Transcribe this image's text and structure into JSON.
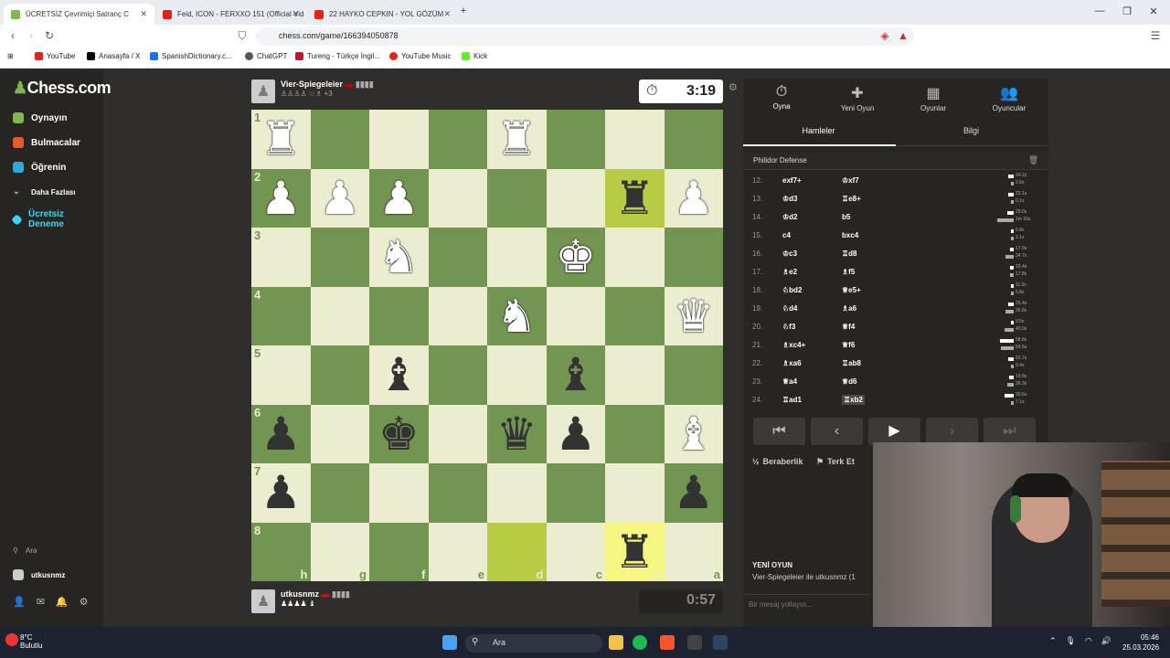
{
  "browser": {
    "tabs": [
      {
        "title": "ÜCRETSİZ Çevrimiçi Satranç C",
        "color": "#81b64c"
      },
      {
        "title": "Feid, ICON - FERXXO 151 (Official Vid",
        "color": "#e62117"
      },
      {
        "title": "22 HAYKO CEPKIN - YOL GÖZÜM",
        "color": "#e62117"
      }
    ],
    "url": "chess.com/game/166394050878",
    "bookmarks": [
      {
        "label": "YouTube",
        "color": "#e62117"
      },
      {
        "label": "Anasayfa / X",
        "color": "#000000"
      },
      {
        "label": "SpanishDictionary.c...",
        "color": "#1a73e8"
      },
      {
        "label": "ChatGPT",
        "color": "#555555"
      },
      {
        "label": "Tureng - Türkçe İngil...",
        "color": "#c4153b"
      },
      {
        "label": "YouTube Music",
        "color": "#e62117"
      },
      {
        "label": "Kick",
        "color": "#53fc18"
      }
    ]
  },
  "sidebar": {
    "logo": "Chess.com",
    "items": [
      {
        "label": "Oynayın",
        "color": "#81b64c"
      },
      {
        "label": "Bulmacalar",
        "color": "#e8582a"
      },
      {
        "label": "Öğrenin",
        "color": "#2da8dd"
      },
      {
        "label": "Daha Fazlası",
        "color": "#bbbbbb"
      },
      {
        "label": "Ücretsiz Deneme",
        "color": "#3ad5f5"
      }
    ],
    "search": "Ara",
    "username": "utkusnmz"
  },
  "game": {
    "top_player": {
      "name": "Vier-Spiegeleier",
      "rating": "+3"
    },
    "bottom_player": {
      "name": "utkusnmz"
    },
    "top_clock": "3:19",
    "bottom_clock": "0:57",
    "board": [
      [
        "wR",
        "",
        "",
        "",
        "wR",
        "",
        "",
        ""
      ],
      [
        "wP",
        "wP",
        "wP",
        "",
        "",
        "",
        "bR",
        "wP"
      ],
      [
        "",
        "",
        "wN",
        "",
        "",
        "wK",
        "",
        ""
      ],
      [
        "",
        "",
        "",
        "",
        "wN",
        "",
        "",
        "wQ"
      ],
      [
        "",
        "",
        "bB",
        "",
        "",
        "bB",
        "",
        ""
      ],
      [
        "bP",
        "",
        "bK",
        "",
        "bQ",
        "bP",
        "",
        "wB"
      ],
      [
        "bP",
        "",
        "",
        "",
        "",
        "",
        "",
        "bP"
      ],
      [
        "",
        "",
        "",
        "",
        "",
        "",
        "bR",
        ""
      ]
    ],
    "ranks": [
      "1",
      "2",
      "3",
      "4",
      "5",
      "6",
      "7",
      "8"
    ],
    "files": [
      "h",
      "g",
      "f",
      "e",
      "d",
      "c",
      "b",
      "a"
    ]
  },
  "panel": {
    "tabs": [
      {
        "label": "Oyna",
        "icon": "⏱"
      },
      {
        "label": "Yeni Oyun",
        "icon": "✚"
      },
      {
        "label": "Oyunlar",
        "icon": "▦"
      },
      {
        "label": "Oyuncular",
        "icon": "👥"
      }
    ],
    "subtabs": [
      "Hamleler",
      "Bilgi"
    ],
    "opening": "Philidor Defense",
    "moves": [
      {
        "n": "12.",
        "w": "exf7+",
        "b": "♔xf7",
        "t1": "24.2s",
        "t2": "2.6s"
      },
      {
        "n": "13.",
        "w": "♔d3",
        "b": "♖e8+",
        "t1": "23.1s",
        "t2": "0.1s"
      },
      {
        "n": "14.",
        "w": "♔d2",
        "b": "b5",
        "t1": "29.0s",
        "t2": "1m 16s"
      },
      {
        "n": "15.",
        "w": "c4",
        "b": "bxc4",
        "t1": "5.8s",
        "t2": "2.1s"
      },
      {
        "n": "16.",
        "w": "♔c3",
        "b": "♖d8",
        "t1": "17.9s",
        "t2": "34.7s"
      },
      {
        "n": "17.",
        "w": "♗e2",
        "b": "♗f5",
        "t1": "15.4s",
        "t2": "17.8s"
      },
      {
        "n": "18.",
        "w": "♘bd2",
        "b": "♕e5+",
        "t1": "11.0s",
        "t2": "5.8s"
      },
      {
        "n": "19.",
        "w": "♘d4",
        "b": "♗a6",
        "t1": "25.4s",
        "t2": "36.8s"
      },
      {
        "n": "20.",
        "w": "♘f3",
        "b": "♕f4",
        "t1": "9.5s",
        "t2": "40.0s"
      },
      {
        "n": "21.",
        "w": "♗xc4+",
        "b": "♕f6",
        "t1": "58.8s",
        "t2": "54.6s"
      },
      {
        "n": "22.",
        "w": "♗xa6",
        "b": "♖ab8",
        "t1": "22.7s",
        "t2": "9.4s"
      },
      {
        "n": "23.",
        "w": "♕a4",
        "b": "♕d6",
        "t1": "19.8s",
        "t2": "26.3s"
      },
      {
        "n": "24.",
        "w": "♖ad1",
        "b": "♖xb2",
        "t1": "39.6s",
        "t2": "7.1s"
      }
    ],
    "draw": "Beraberlik",
    "resign": "Terk Et",
    "new_game": "YENİ OYUN",
    "new_game_detail": "Vier-Spiegeleier ile utkusnmz (1",
    "message_placeholder": "Bir mesaj yollayın..."
  },
  "taskbar": {
    "weather_temp": "8°C",
    "weather_desc": "Bulutlu",
    "search": "Ara",
    "time": "05:46",
    "date": "25.03.2026"
  }
}
